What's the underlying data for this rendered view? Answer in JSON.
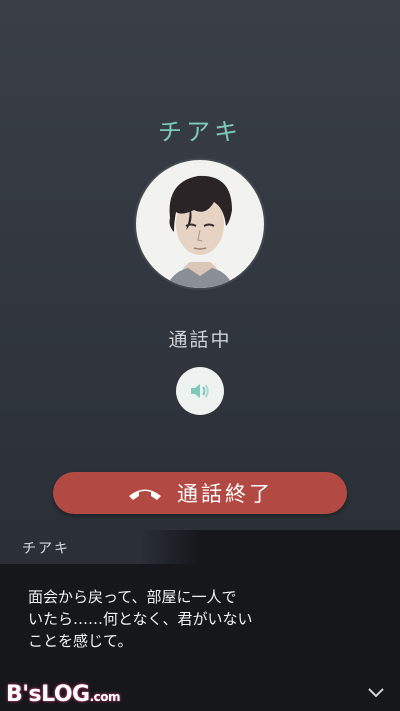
{
  "call": {
    "caller_name": "チアキ",
    "status": "通話中",
    "speaker_icon": "speaker-icon",
    "end_call_label": "通話終了",
    "end_call_icon": "hang-up-phone-icon",
    "accent_color": "#7ec8bd",
    "end_call_color": "#b24a43"
  },
  "dialogue": {
    "speaker": "チアキ",
    "text": "面会から戻って、部屋に一人で\nいたら……何となく、君がいない\nことを感じて。",
    "next_icon": "chevron-down-icon"
  },
  "watermark": {
    "text": "B'sLOG",
    "suffix": ".com"
  }
}
